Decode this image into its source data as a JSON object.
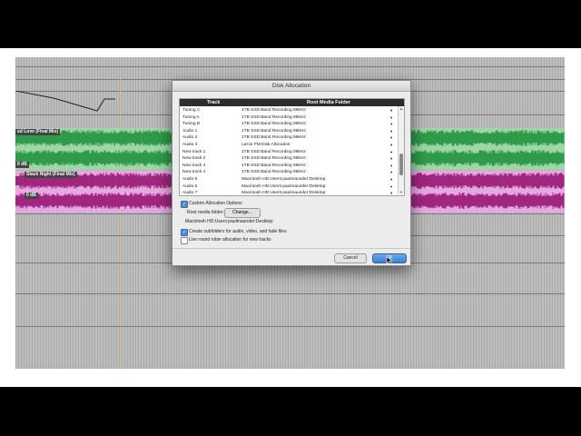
{
  "dialog": {
    "title": "Disk Allocation",
    "columns": {
      "track": "Track",
      "folder": "Root Media Folder"
    },
    "rows": [
      {
        "track": "Tuning C",
        "folder": "1TB SSD:Band Recording 96kHz:"
      },
      {
        "track": "Tuning A",
        "folder": "1TB SSD:Band Recording 96kHz:"
      },
      {
        "track": "Tuning B",
        "folder": "1TB SSD:Band Recording 96kHz:"
      },
      {
        "track": "Audio 1",
        "folder": "1TB SSD:Band Recording 96kHz:"
      },
      {
        "track": "Audio 2",
        "folder": "1TB SSD:Band Recording 96kHz:"
      },
      {
        "track": "Audio 4",
        "folder": "LaCie FM:Disk Allocation:"
      },
      {
        "track": "New track 1",
        "folder": "1TB SSD:Band Recording 96kHz:"
      },
      {
        "track": "New track 2",
        "folder": "1TB SSD:Band Recording 96kHz:"
      },
      {
        "track": "New track 3",
        "folder": "1TB SSD:Band Recording 96kHz:"
      },
      {
        "track": "New track 4",
        "folder": "1TB SSD:Band Recording 96kHz:"
      },
      {
        "track": "Audio 5",
        "folder": "Macintosh HD:Users:paulmaunder:Desktop:"
      },
      {
        "track": "Audio 6",
        "folder": "Macintosh HD:Users:paulmaunder:Desktop:"
      },
      {
        "track": "Audio 7",
        "folder": "Macintosh HD:Users:paulmaunder:Desktop:"
      }
    ],
    "custom_allocation": {
      "label": "Custom Allocation Options",
      "checked": true
    },
    "root_media_label": "Root media folder:",
    "change_button": "Change...",
    "root_media_path": "Macintosh HD:Users:paulmaunder:Desktop:",
    "create_subfolders": {
      "label": "Create subfolders for audio, video, and fade files",
      "checked": true
    },
    "round_robin": {
      "label": "Use round robin allocation for new tracks",
      "checked": false
    },
    "cancel_button": "Cancel",
    "ok_button": "OK"
  },
  "tracks": {
    "green_clip": "ed Love (Final Mix)",
    "pink_clip": "Stack Night (Final Mix)",
    "green_tag": "0 dB",
    "pink_tag": "0 dB"
  },
  "colors": {
    "green_wave": "#2f9a4a",
    "pink_wave": "#a0267f",
    "accent": "#4a8cd8"
  }
}
